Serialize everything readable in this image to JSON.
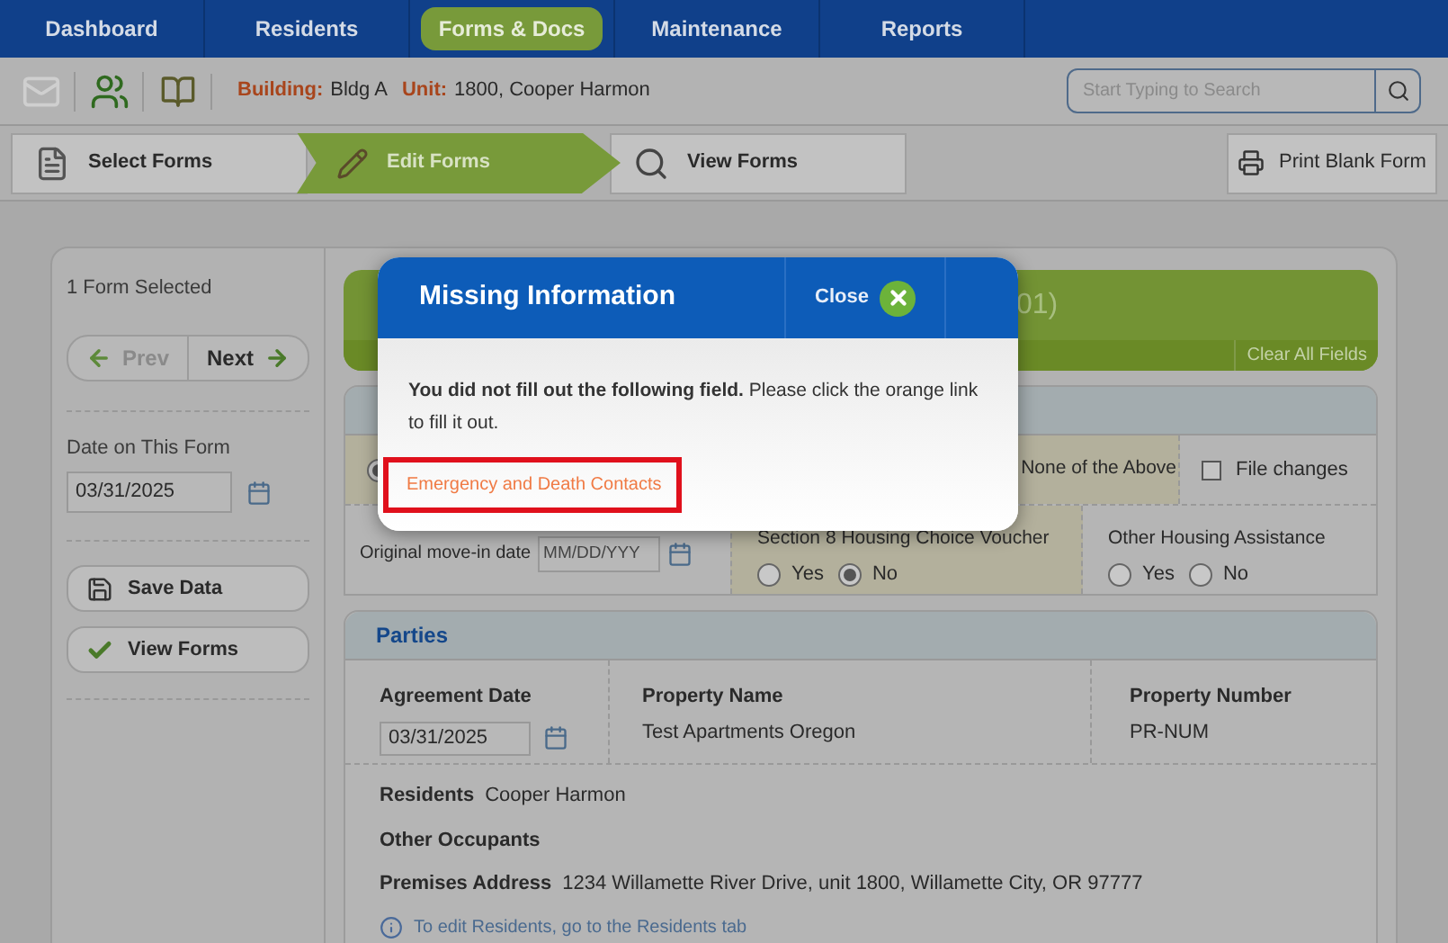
{
  "nav_tabs": [
    {
      "label": "Dashboard",
      "selected": false
    },
    {
      "label": "Residents",
      "selected": false
    },
    {
      "label": "Forms & Docs",
      "selected": true
    },
    {
      "label": "Maintenance",
      "selected": false
    },
    {
      "label": "Reports",
      "selected": false
    }
  ],
  "toolbar": {
    "building_label": "Building:",
    "building": "Bldg A",
    "unit_label": "Unit:",
    "unit": "1800, Cooper Harmon",
    "search": {
      "placeholder": "Start Typing to Search"
    }
  },
  "steps": [
    {
      "kind": "select",
      "label": "Select Forms",
      "selected": false
    },
    {
      "kind": "edit",
      "label": "Edit Forms",
      "selected": true
    },
    {
      "kind": "view",
      "label": "View Forms",
      "selected": false
    }
  ],
  "print_button": "Print Blank Form",
  "sidebar": {
    "selection_count": "1 Form Selected",
    "prev": {
      "label": "Prev",
      "disabled": true
    },
    "next": {
      "label": "Next",
      "disabled": false
    },
    "date_label": "Date on This Form",
    "date_value": "03/31/2025",
    "buttons": [
      {
        "kind": "save",
        "label": "Save Data"
      },
      {
        "kind": "view",
        "label": "View Forms"
      }
    ]
  },
  "form_header": {
    "title": "01)",
    "clear_button": "Clear All Fields"
  },
  "household": {
    "first_radio": {
      "selected": true
    },
    "none_label": "None of the Above",
    "file_changes": {
      "label": "File changes",
      "checked": false
    },
    "move_in": {
      "label": "Original move-in date",
      "placeholder": "MM/DD/YYY"
    },
    "assistance": [
      {
        "label": "Section 8 Housing Choice Voucher",
        "options": [
          {
            "label": "Yes",
            "selected": false
          },
          {
            "label": "No",
            "selected": true
          }
        ]
      },
      {
        "label": "Other Housing Assistance",
        "options": [
          {
            "label": "Yes",
            "selected": false
          },
          {
            "label": "No",
            "selected": false
          }
        ]
      }
    ]
  },
  "parties": {
    "title": "Parties",
    "agreement_date": {
      "label": "Agreement Date",
      "value": "03/31/2025"
    },
    "property_name": {
      "label": "Property Name",
      "value": "Test Apartments Oregon"
    },
    "property_number": {
      "label": "Property Number",
      "value": "PR-NUM"
    },
    "residents": {
      "label": "Residents",
      "value": "Cooper Harmon"
    },
    "other_occupants": {
      "label": "Other Occupants"
    },
    "premises_address": {
      "label": "Premises Address",
      "value": "1234 Willamette River Drive, unit 1800, Willamette City, OR 97777"
    },
    "note": "To edit Residents, go to the Residents tab"
  },
  "modal": {
    "title": "Missing Information",
    "close": "Close",
    "message": "**You did not fill out the following field.** Please click the orange link to fill it out.",
    "links": [
      {
        "label": "Emergency and Death Contacts",
        "highlighted": true
      }
    ]
  }
}
